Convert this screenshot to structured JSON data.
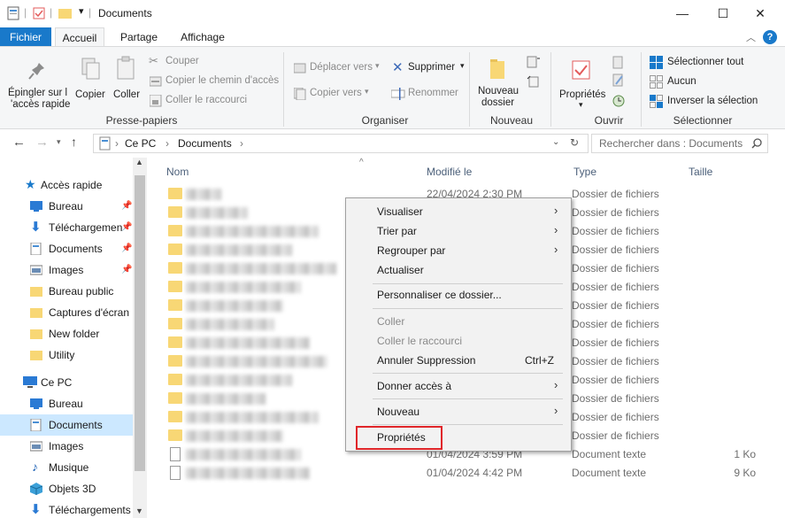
{
  "window": {
    "title": "Documents",
    "controls": {
      "minimize": "—",
      "maximize": "☐",
      "close": "✕"
    }
  },
  "ribbon_tabs": [
    "Fichier",
    "Accueil",
    "Partage",
    "Affichage"
  ],
  "ribbon": {
    "groups": {
      "clipboard": "Presse-papiers",
      "organize": "Organiser",
      "new": "Nouveau",
      "open": "Ouvrir",
      "select": "Sélectionner"
    },
    "pin_label_1": "Épingler sur l",
    "pin_label_2": "'accès rapide",
    "copy": "Copier",
    "paste": "Coller",
    "cut": "Couper",
    "copy_path": "Copier le chemin d'accès",
    "paste_shortcut": "Coller le raccourci",
    "move_to": "Déplacer vers",
    "copy_to": "Copier vers",
    "delete": "Supprimer",
    "rename": "Renommer",
    "new_folder_1": "Nouveau",
    "new_folder_2": "dossier",
    "properties": "Propriétés",
    "select_all": "Sélectionner tout",
    "select_none": "Aucun",
    "invert_selection": "Inverser la sélection"
  },
  "address": {
    "path": [
      "Ce PC",
      "Documents"
    ],
    "search_placeholder": "Rechercher dans : Documents"
  },
  "nav": {
    "quick_access": "Accès rapide",
    "items": [
      {
        "label": "Bureau",
        "pinned": true
      },
      {
        "label": "Téléchargemen",
        "pinned": true
      },
      {
        "label": "Documents",
        "pinned": true
      },
      {
        "label": "Images",
        "pinned": true
      },
      {
        "label": "Bureau public"
      },
      {
        "label": "Captures d'écran"
      },
      {
        "label": "New folder"
      },
      {
        "label": "Utility"
      }
    ],
    "this_pc": "Ce PC",
    "pc_items": [
      "Bureau",
      "Documents",
      "Images",
      "Musique",
      "Objets 3D",
      "Téléchargements"
    ]
  },
  "columns": {
    "name": "Nom",
    "modified": "Modifié le",
    "type": "Type",
    "size": "Taille"
  },
  "files": [
    {
      "modified": "22/04/2024 2:30 PM",
      "type": "Dossier de fichiers",
      "size": ""
    },
    {
      "modified": "",
      "type": "Dossier de fichiers",
      "size": ""
    },
    {
      "modified": "",
      "type": "Dossier de fichiers",
      "size": ""
    },
    {
      "modified": "",
      "type": "Dossier de fichiers",
      "size": ""
    },
    {
      "modified": "",
      "type": "Dossier de fichiers",
      "size": ""
    },
    {
      "modified": "",
      "type": "Dossier de fichiers",
      "size": ""
    },
    {
      "modified": "",
      "type": "Dossier de fichiers",
      "size": ""
    },
    {
      "modified": "",
      "type": "Dossier de fichiers",
      "size": ""
    },
    {
      "modified": "",
      "type": "Dossier de fichiers",
      "size": ""
    },
    {
      "modified": "",
      "type": "Dossier de fichiers",
      "size": ""
    },
    {
      "modified": "",
      "type": "Dossier de fichiers",
      "size": ""
    },
    {
      "modified": "",
      "type": "Dossier de fichiers",
      "size": ""
    },
    {
      "modified": "",
      "type": "Dossier de fichiers",
      "size": ""
    },
    {
      "modified": "",
      "type": "Dossier de fichiers",
      "size": ""
    },
    {
      "modified": "01/04/2024 3:59 PM",
      "type": "Document texte",
      "size": "1 Ko"
    },
    {
      "modified": "01/04/2024 4:42 PM",
      "type": "Document texte",
      "size": "9 Ko"
    }
  ],
  "context_menu": {
    "view": "Visualiser",
    "sort_by": "Trier par",
    "group_by": "Regrouper par",
    "refresh": "Actualiser",
    "customize": "Personnaliser ce dossier...",
    "paste": "Coller",
    "paste_shortcut": "Coller le raccourci",
    "undo_delete": "Annuler Suppression",
    "undo_shortcut": "Ctrl+Z",
    "give_access": "Donner accès à",
    "new": "Nouveau",
    "properties": "Propriétés"
  },
  "colors": {
    "accent": "#1979ca",
    "highlight": "#e0262a",
    "folder": "#f8d775"
  }
}
